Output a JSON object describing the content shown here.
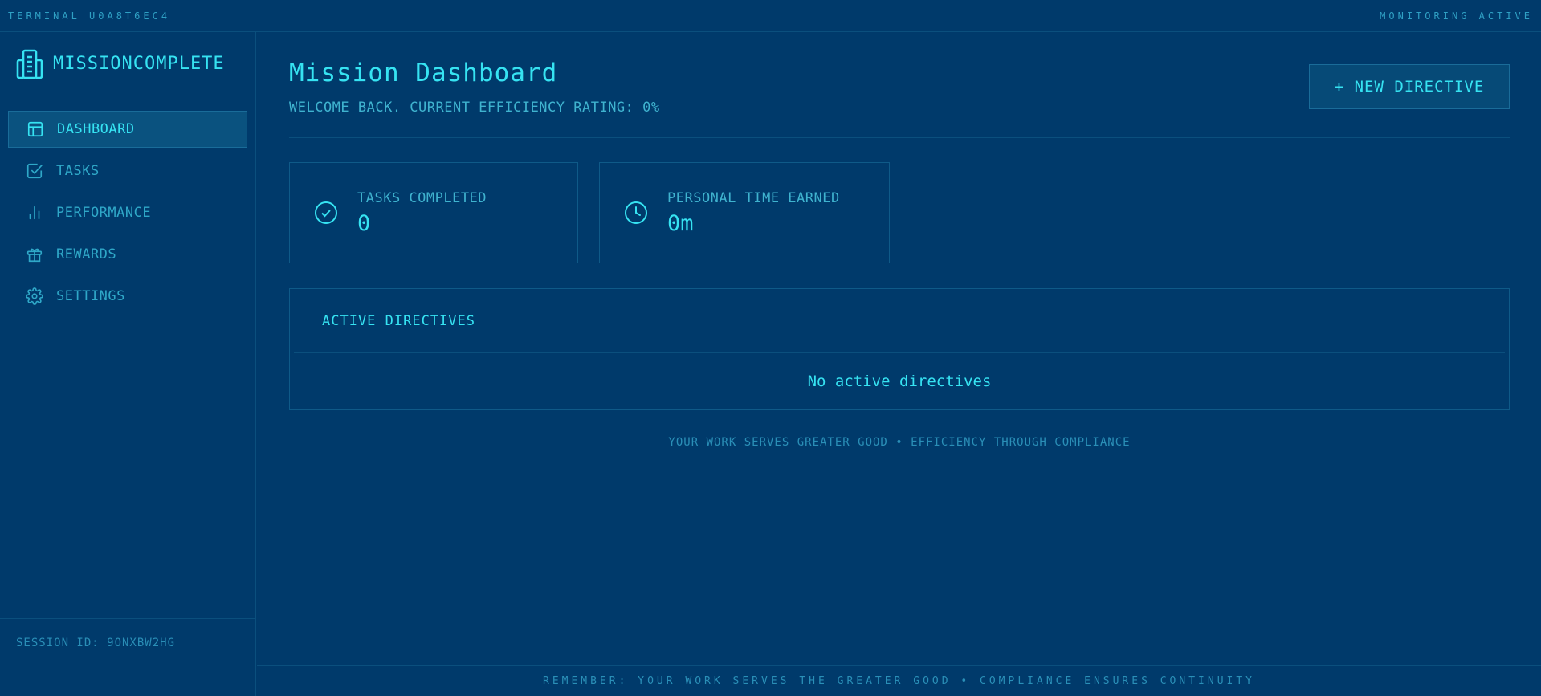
{
  "topbar": {
    "terminal": "TERMINAL U0A8T6EC4",
    "status": "MONITORING ACTIVE"
  },
  "brand": {
    "name": "MISSIONCOMPLETE",
    "icon": "building-icon"
  },
  "sidebar": {
    "items": [
      {
        "label": "DASHBOARD",
        "icon": "layout-icon",
        "active": true
      },
      {
        "label": "TASKS",
        "icon": "checkbox-icon"
      },
      {
        "label": "PERFORMANCE",
        "icon": "bar-chart-icon"
      },
      {
        "label": "REWARDS",
        "icon": "gift-icon"
      },
      {
        "label": "SETTINGS",
        "icon": "gear-icon"
      }
    ],
    "session": "SESSION ID: 9ONXBW2HG"
  },
  "main": {
    "title": "Mission Dashboard",
    "welcome": "WELCOME BACK. CURRENT EFFICIENCY RATING: 0%",
    "new_button": "+ NEW DIRECTIVE",
    "stats": [
      {
        "label": "TASKS COMPLETED",
        "value": "0",
        "icon": "check-circle-icon"
      },
      {
        "label": "PERSONAL TIME EARNED",
        "value": "0m",
        "icon": "clock-icon"
      }
    ],
    "directives": {
      "title": "ACTIVE DIRECTIVES",
      "empty": "No active directives"
    },
    "motto": "YOUR WORK SERVES GREATER GOOD • EFFICIENCY THROUGH COMPLIANCE",
    "footer": "REMEMBER: YOUR WORK SERVES THE GREATER GOOD • COMPLIANCE ENSURES CONTINUITY"
  },
  "colors": {
    "background": "#003a6b",
    "accent": "#36e3f2",
    "muted": "#2fa8c8"
  }
}
